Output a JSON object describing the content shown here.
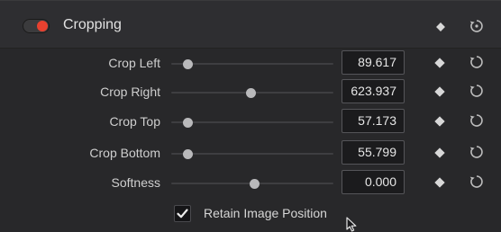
{
  "section": {
    "title": "Cropping",
    "enabled": true,
    "accent_color": "#e8412f"
  },
  "controls": [
    {
      "label": "Crop Left",
      "value": "89.617",
      "slider_level": 0.1
    },
    {
      "label": "Crop Right",
      "value": "623.937",
      "slider_level": 0.49
    },
    {
      "label": "Crop Top",
      "value": "57.173",
      "slider_level": 0.1
    },
    {
      "label": "Crop Bottom",
      "value": "55.799",
      "slider_level": 0.1
    },
    {
      "label": "Softness",
      "value": "0.000",
      "slider_level": 0.51
    }
  ],
  "retain_position": {
    "label": "Retain Image Position",
    "checked": true
  },
  "icons": {
    "keyframe": "keyframe-diamond-icon",
    "reset": "reset-icon",
    "cursor": "mouse-pointer-icon"
  }
}
